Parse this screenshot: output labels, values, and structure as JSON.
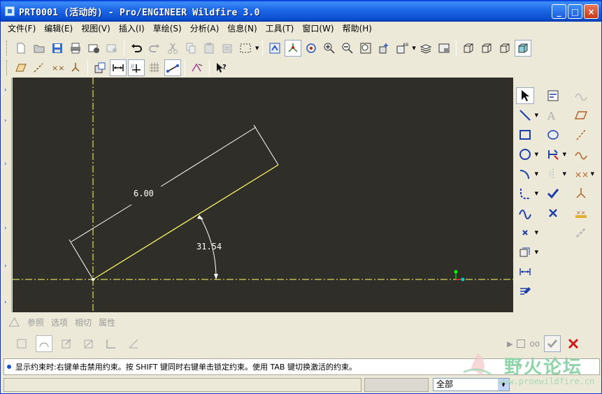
{
  "window": {
    "title": "PRT0001 (活动的) - Pro/ENGINEER Wildfire 3.0"
  },
  "menu": {
    "items": [
      "文件(F)",
      "编辑(E)",
      "视图(V)",
      "插入(I)",
      "草绘(S)",
      "分析(A)",
      "信息(N)",
      "工具(T)",
      "窗口(W)",
      "帮助(H)"
    ]
  },
  "canvas": {
    "dimension_length": "6.00",
    "dimension_angle": "31.54",
    "background_color": "#302e28",
    "sketch_color": "#ffff66",
    "dimension_color": "#ffffff",
    "centerline_color": "#ffff66"
  },
  "dashboard": {
    "tabs": [
      "参照",
      "选项",
      "相切",
      "属性"
    ],
    "glasses_label": "oo"
  },
  "message": {
    "text": "显示约束时:右键单击禁用约束。按 SHIFT 键同时右键单击锁定约束。使用 TAB 键切换激活的约束。"
  },
  "status": {
    "filter_value": "全部"
  },
  "watermark": {
    "title": "野火论坛",
    "url": "www.proewildfire.cn"
  }
}
